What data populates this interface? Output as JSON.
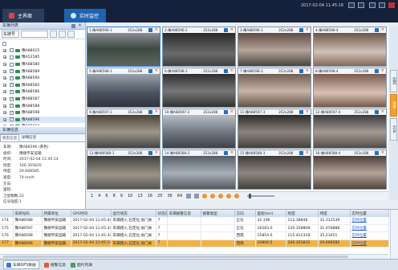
{
  "topbar": {
    "tabs": [
      {
        "label": "主界面"
      },
      {
        "label": "实时监控"
      }
    ],
    "datetime": "2017-02-04 11:45:18"
  },
  "vehicle_list": {
    "title": "车辆列表",
    "search_type": "车牌号",
    "tree": [
      {
        "label": "",
        "checked": false,
        "root": true
      },
      {
        "label": "豫A88015",
        "checked": false
      },
      {
        "label": "豫A52585",
        "checked": false
      },
      {
        "label": "豫A88580",
        "checked": false
      },
      {
        "label": "豫A88589",
        "checked": true
      },
      {
        "label": "豫A88590",
        "checked": true
      },
      {
        "label": "豫A88585",
        "checked": true
      },
      {
        "label": "豫A88586",
        "checked": true
      },
      {
        "label": "豫A88587",
        "checked": true
      },
      {
        "label": "豫A88588",
        "checked": true
      },
      {
        "label": "豫A88598",
        "checked": true
      },
      {
        "label": "豫A88596",
        "checked": true,
        "selected": true
      },
      {
        "label": "豫A88004",
        "checked": false
      }
    ]
  },
  "vehicle_info": {
    "title": "车辆信息",
    "tabs": [
      "状态信息",
      "详细信息"
    ],
    "rows": [
      {
        "k": "车牌:",
        "v": "豫A88596 (黄色)"
      },
      {
        "k": "组织:",
        "v": "豫顺平安运输"
      },
      {
        "k": "时间:",
        "v": "2017-02-04 11:45:14"
      },
      {
        "k": "经度:",
        "v": "106.355835"
      },
      {
        "k": "纬度:",
        "v": "29.668585"
      },
      {
        "k": "速度:",
        "v": "74 km/h"
      },
      {
        "k": "方向:",
        "v": ""
      },
      {
        "k": "里程:",
        "v": ""
      },
      {
        "k": "卫星颗数:",
        "v": "22"
      },
      {
        "k": "信号强度:",
        "v": "1"
      }
    ]
  },
  "video_cells": [
    {
      "title": "1-豫A88596-1",
      "res": "352x288"
    },
    {
      "title": "2-豫A88596-2",
      "res": "352x288"
    },
    {
      "title": "3-豫A88596-3",
      "res": "352x288"
    },
    {
      "title": "4-豫A88596-4",
      "res": "352x288"
    },
    {
      "title": "5-豫A88598-1",
      "res": "352x288"
    },
    {
      "title": "6-豫A88598-2",
      "res": "352x288"
    },
    {
      "title": "7-豫A88598-3",
      "res": "352x288"
    },
    {
      "title": "8-豫A88598-4",
      "res": "352x288"
    },
    {
      "title": "9-豫A88597-1",
      "res": "352x288"
    },
    {
      "title": "10-豫A88597-2",
      "res": "352x288"
    },
    {
      "title": "11-豫A88597-3",
      "res": "352x288"
    },
    {
      "title": "12-豫A88597-4",
      "res": "352x288"
    },
    {
      "title": "13-豫A88588-1",
      "res": "352x288"
    },
    {
      "title": "14-豫A88588-2",
      "res": "352x288"
    },
    {
      "title": "15-豫A88588-3",
      "res": "352x288"
    },
    {
      "title": "16-豫A88588-4",
      "res": "352x288"
    }
  ],
  "grid_controls": {
    "layouts": [
      "1",
      "4",
      "6",
      "8",
      "9",
      "10",
      "13",
      "16",
      "25",
      "36",
      "64"
    ]
  },
  "right_dock": {
    "tabs": [
      "监控",
      "对讲",
      "云台"
    ]
  },
  "table": {
    "columns": [
      "车牌号码",
      "所属单位",
      "GPS时间",
      "运行状态",
      "状态信息",
      "车辆报警信息",
      "报警类型",
      "方向",
      "里程(km)",
      "经度",
      "纬度",
      "实时位置"
    ],
    "rows": [
      {
        "id": "174",
        "cells": [
          "豫A88588",
          "豫顺平安运输",
          "2017-02-04 11:45:44",
          "车辆熄火,已定位,省门关",
          "7",
          "",
          "",
          "正北",
          "32.196",
          "112.38848",
          "32.312539",
          "实时位置"
        ]
      },
      {
        "id": "175",
        "cells": [
          "豫A88597",
          "豫顺平安运输",
          "2017-02-04 11:45:34",
          "车辆熄火,已定位,省门关",
          "7",
          "",
          "",
          "正北",
          "16283.0",
          "120.358808",
          "31.459888",
          "实时位置"
        ]
      },
      {
        "id": "176",
        "cells": [
          "豫A88598",
          "豫顺平安运输",
          "2017-02-04 11:45:34",
          "车辆熄火,已定位,省门关",
          "7",
          "",
          "",
          "西南",
          "15854.6",
          "115.422328",
          "35.23451",
          "实时位置"
        ]
      },
      {
        "id": "177",
        "cells": [
          "豫A88596",
          "豫顺平安运输",
          "2017-02-04 11:45:14",
          "车辆熄火,已定位,省门关",
          "7",
          "",
          "",
          "西南",
          "20800.5",
          "106.355835",
          "29.668585",
          "实时位置"
        ],
        "selected": true
      }
    ]
  },
  "bottom_tabs": [
    "车辆GPS数据",
    "报警信息",
    "图片列表"
  ],
  "colors": {
    "topbar": "#15213a",
    "accent": "#1e63b0",
    "selected_row": "#f2b24a",
    "link": "#1c58c8"
  }
}
